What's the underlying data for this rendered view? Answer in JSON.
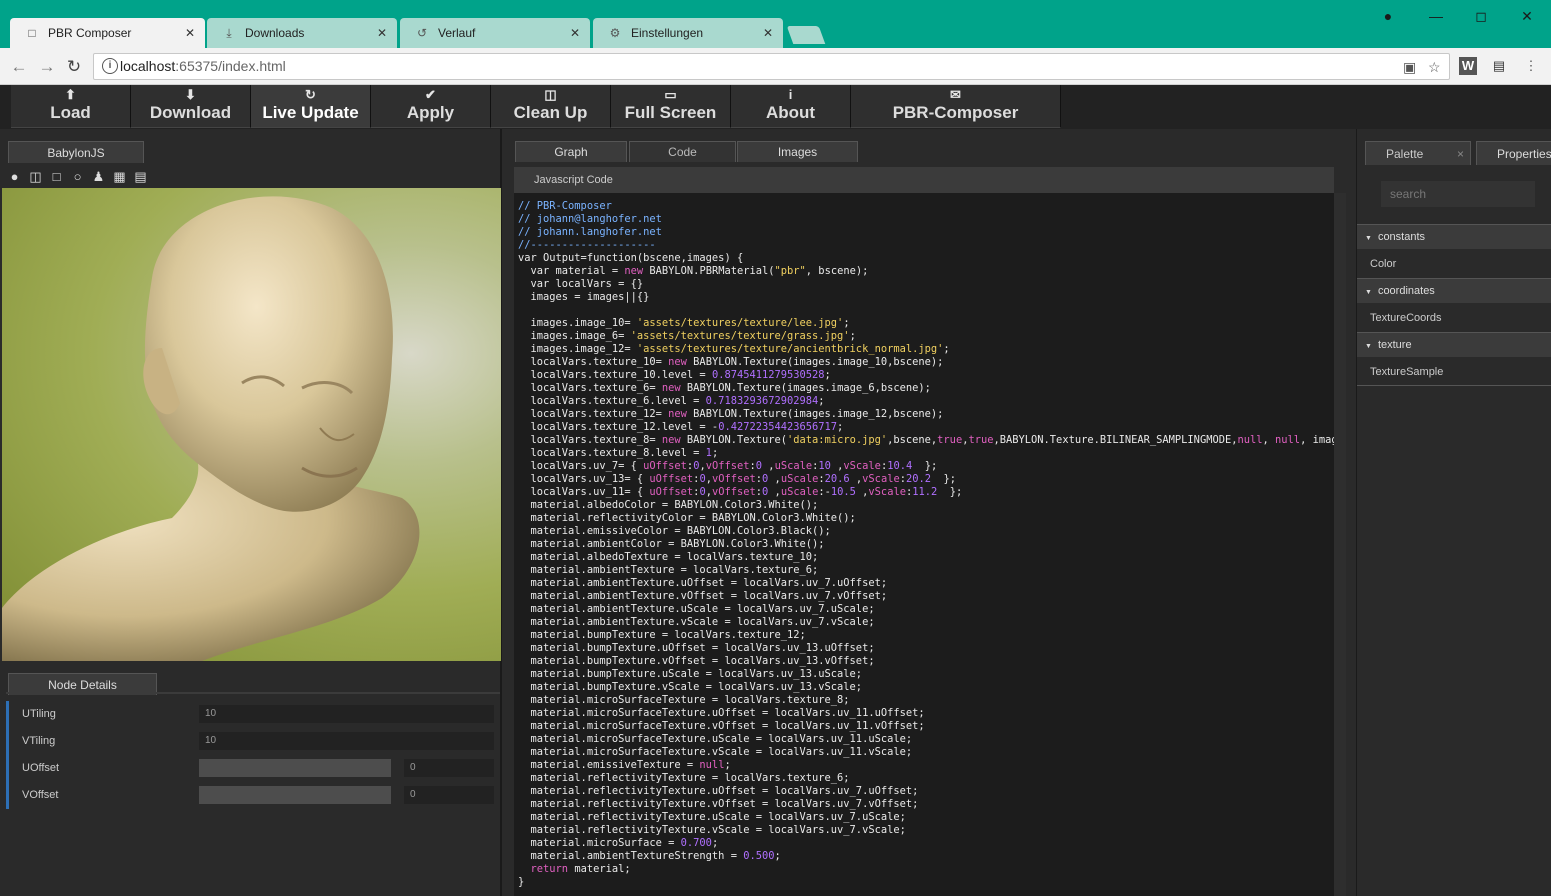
{
  "browser": {
    "tabs": [
      {
        "label": "PBR Composer",
        "icon": "page-icon"
      },
      {
        "label": "Downloads",
        "icon": "download-icon"
      },
      {
        "label": "Verlauf",
        "icon": "history-icon"
      },
      {
        "label": "Einstellungen",
        "icon": "gear-icon"
      }
    ],
    "url_host": "localhost",
    "url_rest": ":65375/index.html"
  },
  "toolbar": {
    "buttons": [
      {
        "label": "Load",
        "icon": "upload-icon"
      },
      {
        "label": "Download",
        "icon": "download-icon"
      },
      {
        "label": "Live Update",
        "icon": "refresh-icon"
      },
      {
        "label": "Apply",
        "icon": "check-circle-icon"
      },
      {
        "label": "Clean Up",
        "icon": "trash-icon"
      },
      {
        "label": "Full Screen",
        "icon": "monitor-icon"
      },
      {
        "label": "About",
        "icon": "info-icon"
      },
      {
        "label": "PBR-Composer",
        "icon": "envelope-icon"
      }
    ]
  },
  "left": {
    "viewer_tab": "BabylonJS",
    "node_details_tab": "Node Details",
    "fields": [
      {
        "label": "UTiling",
        "value": "10"
      },
      {
        "label": "VTiling",
        "value": "10"
      },
      {
        "label": "UOffset",
        "value": "0"
      },
      {
        "label": "VOffset",
        "value": "0"
      }
    ]
  },
  "middle": {
    "tabs": [
      "Graph",
      "Code",
      "Images"
    ],
    "code_header": "Javascript Code"
  },
  "right": {
    "tabs": [
      "Palette",
      "Properties"
    ],
    "tab_close": "×",
    "search_placeholder": "search",
    "groups": [
      {
        "label": "constants",
        "items": [
          "Color"
        ]
      },
      {
        "label": "coordinates",
        "items": [
          "TextureCoords"
        ]
      },
      {
        "label": "texture",
        "items": [
          "TextureSample"
        ]
      }
    ]
  },
  "code_lines": [
    "// PBR-Composer",
    "// johann@langhofer.net",
    "// johann.langhofer.net",
    "//--------------------",
    "var Output=function(bscene,images) {",
    "  var material = new BABYLON.PBRMaterial(\"pbr\", bscene);",
    "  var localVars = {}",
    "  images = images||{}",
    "",
    "  images.image_10= 'assets/textures/texture/lee.jpg';",
    "  images.image_6= 'assets/textures/texture/grass.jpg';",
    "  images.image_12= 'assets/textures/texture/ancientbrick_normal.jpg';",
    "  localVars.texture_10= new BABYLON.Texture(images.image_10,bscene);",
    "  localVars.texture_10.level = 0.8745411279530528;",
    "  localVars.texture_6= new BABYLON.Texture(images.image_6,bscene);",
    "  localVars.texture_6.level = 0.7183293672902984;",
    "  localVars.texture_12= new BABYLON.Texture(images.image_12,bscene);",
    "  localVars.texture_12.level = -0.42722354423656717;",
    "  localVars.texture_8= new BABYLON.Texture('data:micro.jpg',bscene,true,true,BABYLON.Texture.BILINEAR_SAMPLINGMODE,null, null, images.i",
    "  localVars.texture_8.level = 1;",
    "  localVars.uv_7= { uOffset:0,vOffset:0 ,uScale:10 ,vScale:10.4  };",
    "  localVars.uv_13= { uOffset:0,vOffset:0 ,uScale:20.6 ,vScale:20.2  };",
    "  localVars.uv_11= { uOffset:0,vOffset:0 ,uScale:-10.5 ,vScale:11.2  };",
    "  material.albedoColor = BABYLON.Color3.White();",
    "  material.reflectivityColor = BABYLON.Color3.White();",
    "  material.emissiveColor = BABYLON.Color3.Black();",
    "  material.ambientColor = BABYLON.Color3.White();",
    "  material.albedoTexture = localVars.texture_10;",
    "  material.ambientTexture = localVars.texture_6;",
    "  material.ambientTexture.uOffset = localVars.uv_7.uOffset;",
    "  material.ambientTexture.vOffset = localVars.uv_7.vOffset;",
    "  material.ambientTexture.uScale = localVars.uv_7.uScale;",
    "  material.ambientTexture.vScale = localVars.uv_7.vScale;",
    "  material.bumpTexture = localVars.texture_12;",
    "  material.bumpTexture.uOffset = localVars.uv_13.uOffset;",
    "  material.bumpTexture.vOffset = localVars.uv_13.vOffset;",
    "  material.bumpTexture.uScale = localVars.uv_13.uScale;",
    "  material.bumpTexture.vScale = localVars.uv_13.vScale;",
    "  material.microSurfaceTexture = localVars.texture_8;",
    "  material.microSurfaceTexture.uOffset = localVars.uv_11.uOffset;",
    "  material.microSurfaceTexture.vOffset = localVars.uv_11.vOffset;",
    "  material.microSurfaceTexture.uScale = localVars.uv_11.uScale;",
    "  material.microSurfaceTexture.vScale = localVars.uv_11.vScale;",
    "  material.emissiveTexture = null;",
    "  material.reflectivityTexture = localVars.texture_6;",
    "  material.reflectivityTexture.uOffset = localVars.uv_7.uOffset;",
    "  material.reflectivityTexture.vOffset = localVars.uv_7.vOffset;",
    "  material.reflectivityTexture.uScale = localVars.uv_7.uScale;",
    "  material.reflectivityTexture.vScale = localVars.uv_7.vScale;",
    "  material.microSurface = 0.700;",
    "  material.ambientTextureStrength = 0.500;",
    "  return material;",
    "}"
  ],
  "colors": {
    "chrome_accent": "#00a38a",
    "comment": "#7ab3ff",
    "string": "#f0d060",
    "number": "#b070ff",
    "keyword": "#e060c0"
  }
}
